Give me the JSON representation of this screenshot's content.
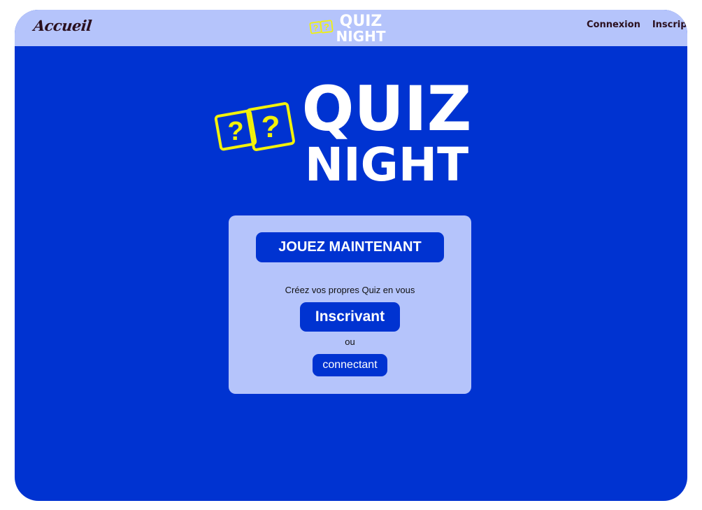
{
  "nav": {
    "home_label": "Accueil",
    "links": [
      {
        "label": "Connexion"
      },
      {
        "label": "Inscription"
      }
    ]
  },
  "logo": {
    "line1": "QUIZ",
    "line2": "NIGHT",
    "die_glyph": "?"
  },
  "card": {
    "play_label": "JOUEZ MAINTENANT",
    "create_text": "Créez vos propres Quiz en vous",
    "register_label": "Inscrivant",
    "or_text": "ou",
    "login_label": "connectant"
  },
  "colors": {
    "background": "#0033d1",
    "navbar": "#b5c4fb",
    "card": "#b5c4fb",
    "button": "#0033d1",
    "logo_text": "#ffffff",
    "dice_outline": "#f2f20a",
    "nav_text": "#2a0f1e"
  }
}
